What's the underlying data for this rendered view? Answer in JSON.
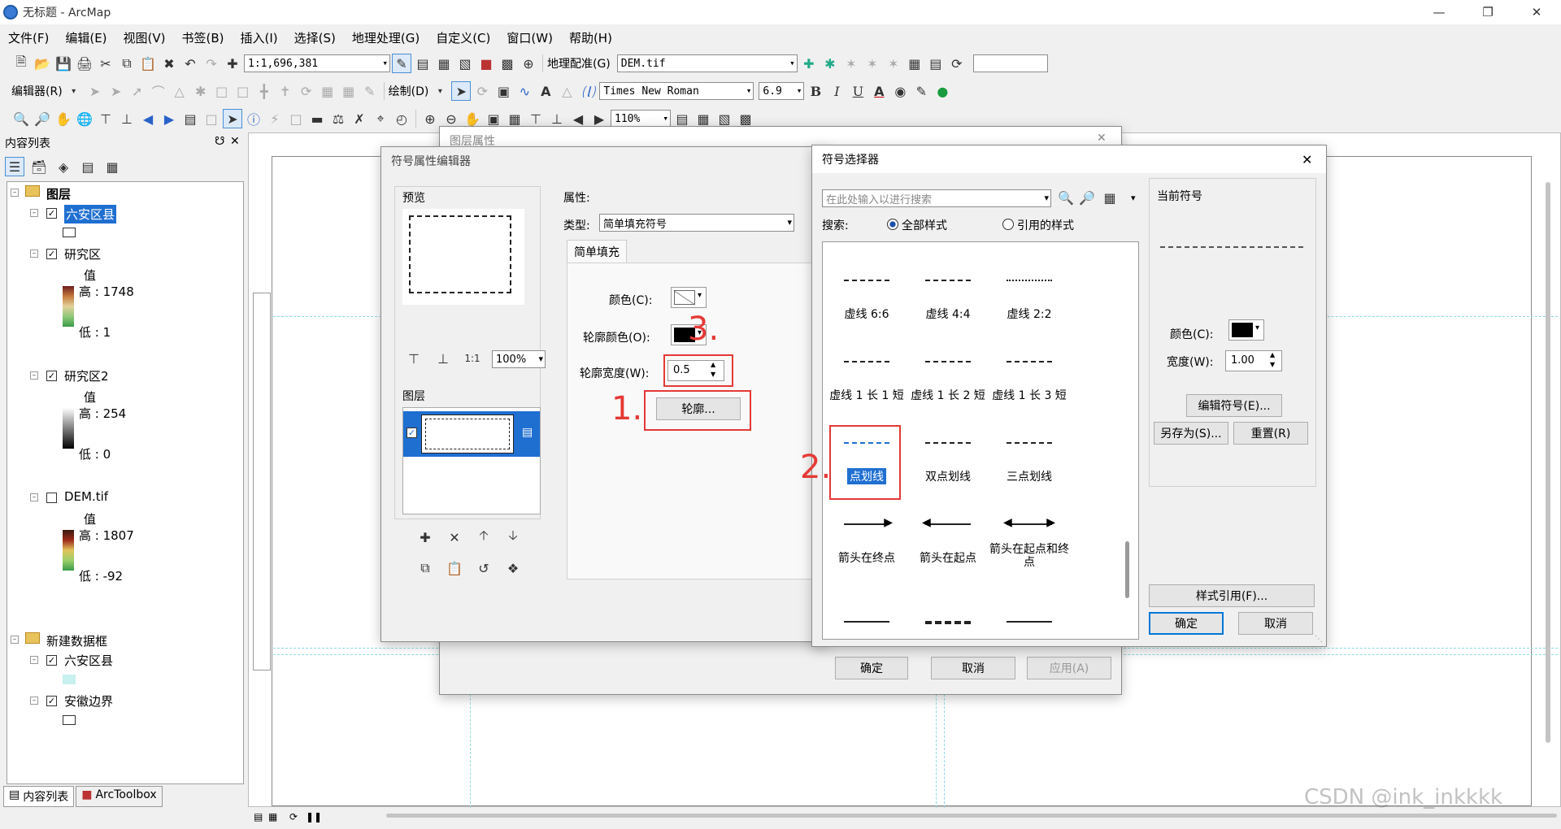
{
  "app": {
    "title": "无标题 - ArcMap"
  },
  "menu": [
    "文件(F)",
    "编辑(E)",
    "视图(V)",
    "书签(B)",
    "插入(I)",
    "选择(S)",
    "地理处理(G)",
    "自定义(C)",
    "窗口(W)",
    "帮助(H)"
  ],
  "toolbar": {
    "scale": "1:1,696,381",
    "georef_label": "地理配准(G)",
    "georef_layer": "DEM.tif",
    "editor_label": "编辑器(R)",
    "draw_label": "绘制(D)",
    "font": "Times New Roman",
    "font_size": "6.9",
    "zoom": "110%"
  },
  "toc": {
    "title": "内容列表",
    "frame1": "图层",
    "layers": [
      {
        "name": "六安区县"
      },
      {
        "name": "研究区",
        "value_label": "值",
        "high": "高 : 1748",
        "low": "低 : 1"
      },
      {
        "name": "研究区2",
        "value_label": "值",
        "high": "高 : 254",
        "low": "低 : 0"
      },
      {
        "name": "DEM.tif",
        "value_label": "值",
        "high": "高 : 1807",
        "low": "低 : -92"
      }
    ],
    "frame2": "新建数据框",
    "layers2": [
      {
        "name": "六安区县"
      },
      {
        "name": "安徽边界"
      }
    ],
    "tab_toc": "内容列表",
    "tab_toolbox": "ArcToolbox"
  },
  "layer_props": {
    "title": "图层属性",
    "ok": "确定",
    "cancel": "取消",
    "apply": "应用(A)"
  },
  "symbol_editor": {
    "title": "符号属性编辑器",
    "preview": "预览",
    "zoom": "100%",
    "layers": "图层",
    "properties": "属性:",
    "type_label": "类型:",
    "type_value": "简单填充符号",
    "tab": "简单填充",
    "color_label": "颜色(C):",
    "outline_color_label": "轮廓颜色(O):",
    "outline_width_label": "轮廓宽度(W):",
    "outline_width_value": "0.5",
    "outline_button": "轮廓..."
  },
  "symbol_selector": {
    "title": "符号选择器",
    "search_placeholder": "在此处输入以进行搜索",
    "search_label": "搜索:",
    "all_styles": "全部样式",
    "ref_styles": "引用的样式",
    "current_symbol": "当前符号",
    "color_label": "颜色(C):",
    "width_label": "宽度(W):",
    "width_value": "1.00",
    "edit_symbol": "编辑符号(E)...",
    "save_as": "另存为(S)...",
    "reset": "重置(R)",
    "style_ref": "样式引用(F)...",
    "ok": "确定",
    "cancel": "取消",
    "symbols": [
      "虚线 6:6",
      "虚线 4:4",
      "虚线 2:2",
      "虚线 1 长 1 短",
      "虚线 1 长 2 短",
      "虚线 1 长 3 短",
      "点划线",
      "双点划线",
      "三点划线",
      "箭头在终点",
      "箭头在起点",
      "箭头在起点和终点"
    ]
  },
  "annotations": {
    "a1": "1.",
    "a2": "2.",
    "a3": "3."
  },
  "watermark": "CSDN @ink_inkkkk"
}
